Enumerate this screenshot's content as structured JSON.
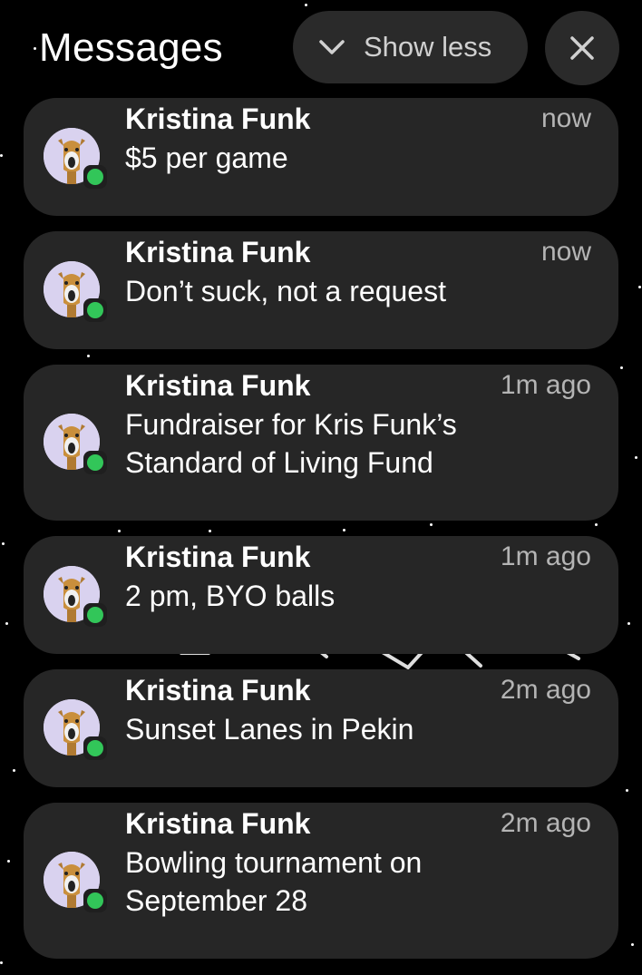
{
  "header": {
    "title": "Messages",
    "show_less_label": "Show less"
  },
  "icons": {
    "chevron": "chevron-down-icon",
    "close": "close-icon",
    "app_badge": "messages-app-icon"
  },
  "colors": {
    "card_bg": "#262626",
    "button_bg": "#2a2a2a",
    "badge_green": "#32c659",
    "avatar_bg": "#d9d2ef",
    "time_gray": "#b4b4b4"
  },
  "notifications": [
    {
      "sender": "Kristina Funk",
      "time": "now",
      "message": "$5 per game"
    },
    {
      "sender": "Kristina Funk",
      "time": "now",
      "message": "Don’t suck, not a request"
    },
    {
      "sender": "Kristina Funk",
      "time": "1m ago",
      "message": "Fundraiser for Kris Funk’s Standard of Living Fund"
    },
    {
      "sender": "Kristina Funk",
      "time": "1m ago",
      "message": "2 pm, BYO balls"
    },
    {
      "sender": "Kristina Funk",
      "time": "2m ago",
      "message": "Sunset Lanes in Pekin"
    },
    {
      "sender": "Kristina Funk",
      "time": "2m ago",
      "message": "Bowling tournament on September 28"
    }
  ]
}
